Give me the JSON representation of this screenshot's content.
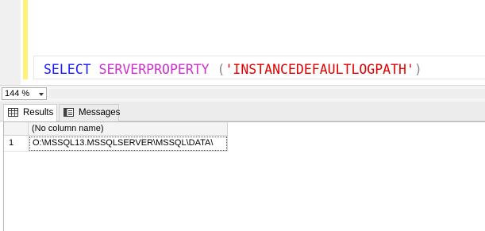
{
  "editor": {
    "tokens": {
      "keyword": "SELECT",
      "function": "SERVERPROPERTY",
      "open_paren": " (",
      "string": "'INSTANCEDEFAULTLOGPATH'",
      "close_paren": ")"
    }
  },
  "zoom": {
    "value": "144 %"
  },
  "tabs": [
    {
      "label": "Results",
      "icon": "grid-icon",
      "active": true
    },
    {
      "label": "Messages",
      "icon": "messages-icon",
      "active": false
    }
  ],
  "results": {
    "columns": [
      "(No column name)"
    ],
    "rows": [
      {
        "num": "1",
        "cells": [
          "O:\\MSSQL13.MSSQLSERVER\\MSSQL\\DATA\\"
        ]
      }
    ]
  },
  "colors": {
    "keyword": "#1a1aff",
    "function": "#d12fd1",
    "string": "#e00000",
    "change_bar": "#fff27a"
  }
}
